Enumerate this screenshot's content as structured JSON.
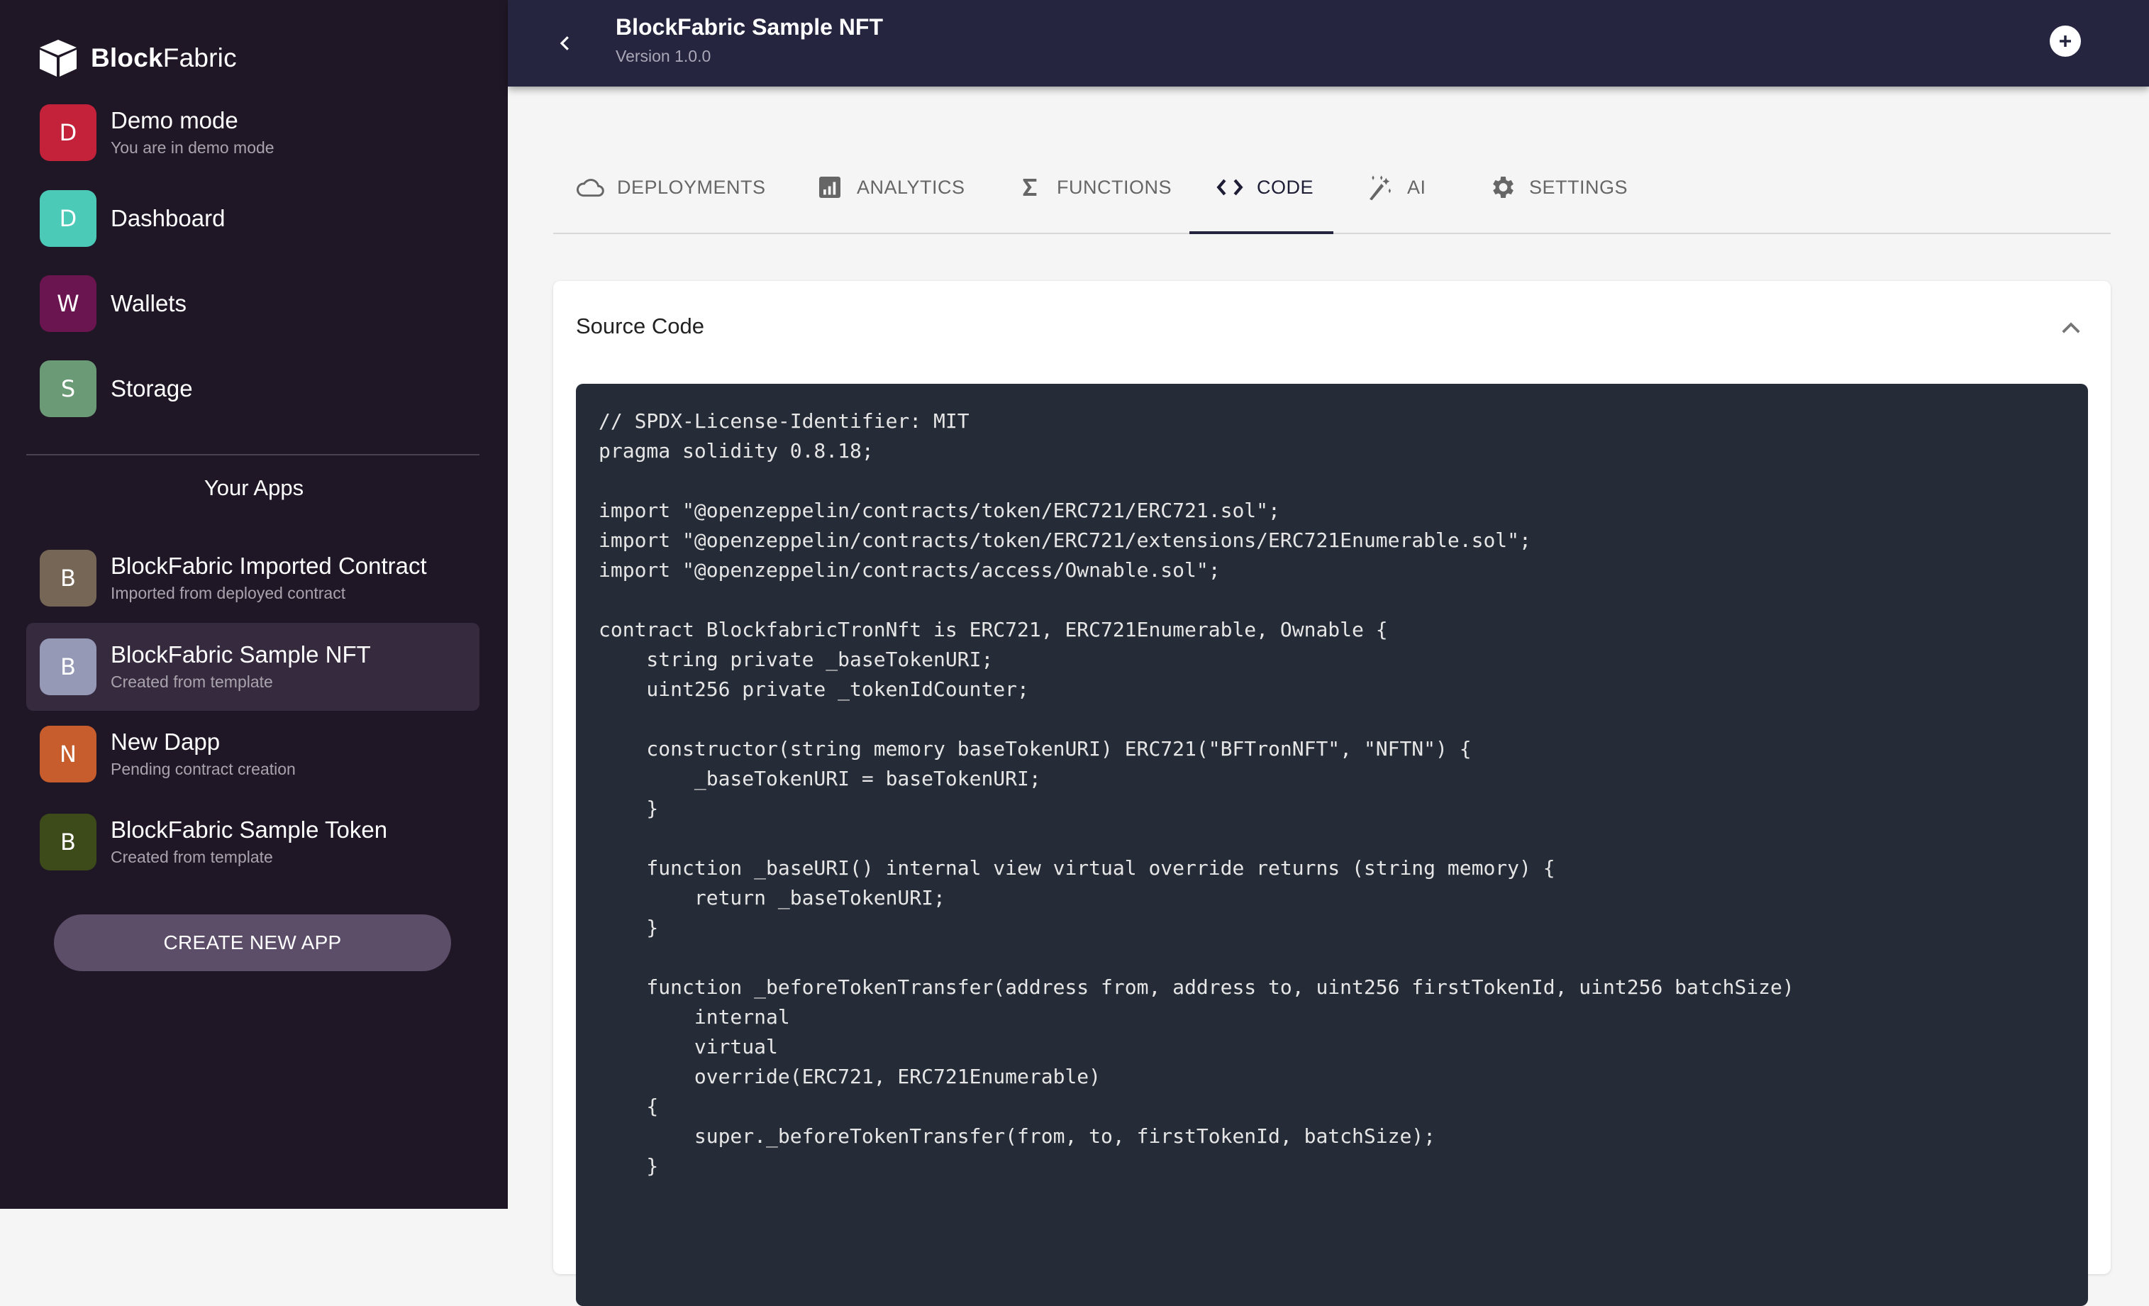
{
  "brand": {
    "bold": "Block",
    "light": "Fabric"
  },
  "sidebar": {
    "nav": [
      {
        "letter": "D",
        "title": "Demo mode",
        "subtitle": "You are in demo mode",
        "color": "#c4213a"
      },
      {
        "letter": "D",
        "title": "Dashboard",
        "subtitle": "",
        "color": "#4bcab8"
      },
      {
        "letter": "W",
        "title": "Wallets",
        "subtitle": "",
        "color": "#6a1550"
      },
      {
        "letter": "S",
        "title": "Storage",
        "subtitle": "",
        "color": "#6b9a76"
      }
    ],
    "apps_heading": "Your Apps",
    "apps": [
      {
        "letter": "B",
        "title": "BlockFabric Imported Contract",
        "subtitle": "Imported from deployed contract",
        "color": "#766656",
        "active": false
      },
      {
        "letter": "B",
        "title": "BlockFabric Sample NFT",
        "subtitle": "Created from template",
        "color": "#9599b5",
        "active": true
      },
      {
        "letter": "N",
        "title": "New Dapp",
        "subtitle": "Pending contract creation",
        "color": "#c75d2c",
        "active": false
      },
      {
        "letter": "B",
        "title": "BlockFabric Sample Token",
        "subtitle": "Created from template",
        "color": "#3d4a1a",
        "active": false
      }
    ],
    "create_button": "CREATE NEW APP"
  },
  "header": {
    "title": "BlockFabric Sample NFT",
    "version": "Version 1.0.0"
  },
  "tabs": [
    {
      "label": "DEPLOYMENTS",
      "icon": "cloud-icon",
      "active": false
    },
    {
      "label": "ANALYTICS",
      "icon": "bar-chart-icon",
      "active": false
    },
    {
      "label": "FUNCTIONS",
      "icon": "sigma-icon",
      "active": false
    },
    {
      "label": "CODE",
      "icon": "code-icon",
      "active": true
    },
    {
      "label": "AI",
      "icon": "magic-wand-icon",
      "active": false
    },
    {
      "label": "SETTINGS",
      "icon": "gear-icon",
      "active": false
    }
  ],
  "card": {
    "title": "Source Code",
    "code": "// SPDX-License-Identifier: MIT\npragma solidity 0.8.18;\n\nimport \"@openzeppelin/contracts/token/ERC721/ERC721.sol\";\nimport \"@openzeppelin/contracts/token/ERC721/extensions/ERC721Enumerable.sol\";\nimport \"@openzeppelin/contracts/access/Ownable.sol\";\n\ncontract BlockfabricTronNft is ERC721, ERC721Enumerable, Ownable {\n    string private _baseTokenURI;\n    uint256 private _tokenIdCounter;\n\n    constructor(string memory baseTokenURI) ERC721(\"BFTronNFT\", \"NFTN\") {\n        _baseTokenURI = baseTokenURI;\n    }\n\n    function _baseURI() internal view virtual override returns (string memory) {\n        return _baseTokenURI;\n    }\n\n    function _beforeTokenTransfer(address from, address to, uint256 firstTokenId, uint256 batchSize)\n        internal\n        virtual\n        override(ERC721, ERC721Enumerable)\n    {\n        super._beforeTokenTransfer(from, to, firstTokenId, batchSize);\n    }\n"
  }
}
